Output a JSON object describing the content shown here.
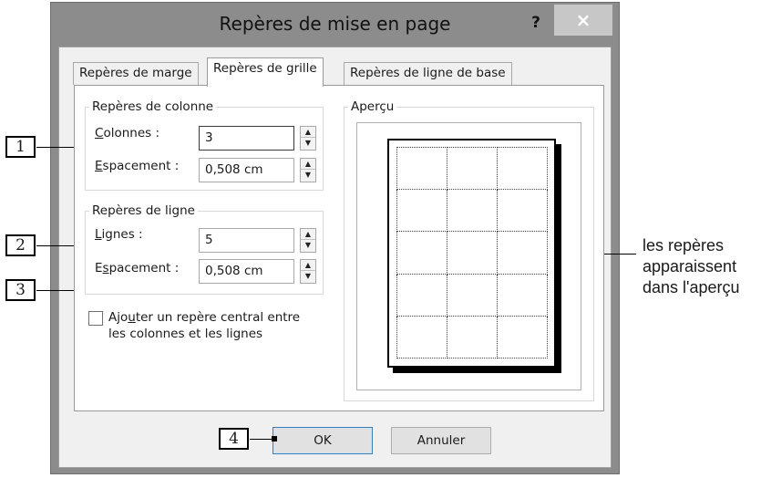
{
  "window": {
    "title": "Repères de mise en page",
    "help_label": "?",
    "close_label": "×"
  },
  "tabs": [
    {
      "label": "Repères de marge",
      "active": false
    },
    {
      "label": "Repères de grille",
      "active": true
    },
    {
      "label": "Repères de ligne de base",
      "active": false
    }
  ],
  "column_guides": {
    "title": "Repères de colonne",
    "columns_label_pre": "",
    "columns_label_u": "C",
    "columns_label_post": "olonnes :",
    "columns_value": "3",
    "spacing_label_pre": "",
    "spacing_label_u": "E",
    "spacing_label_post": "spacement :",
    "spacing_value": "0,508 cm"
  },
  "row_guides": {
    "title": "Repères de ligne",
    "rows_label_pre": "",
    "rows_label_u": "L",
    "rows_label_post": "ignes :",
    "rows_value": "5",
    "spacing_label_pre": "E",
    "spacing_label_u": "s",
    "spacing_label_post": "pacement :",
    "spacing_value": "0,508 cm"
  },
  "center_guide": {
    "line1_pre": "Ajo",
    "line1_u": "u",
    "line1_post": "ter un repère central entre",
    "line2": "les colonnes et les lignes",
    "checked": false
  },
  "preview": {
    "title": "Aperçu",
    "grid_columns": 3,
    "grid_rows": 5
  },
  "buttons": {
    "ok": "OK",
    "cancel": "Annuler"
  },
  "callouts": [
    "1",
    "2",
    "3",
    "4"
  ],
  "annotation": {
    "line1": "les repères",
    "line2": "apparaissent",
    "line3": "dans l'aperçu"
  }
}
